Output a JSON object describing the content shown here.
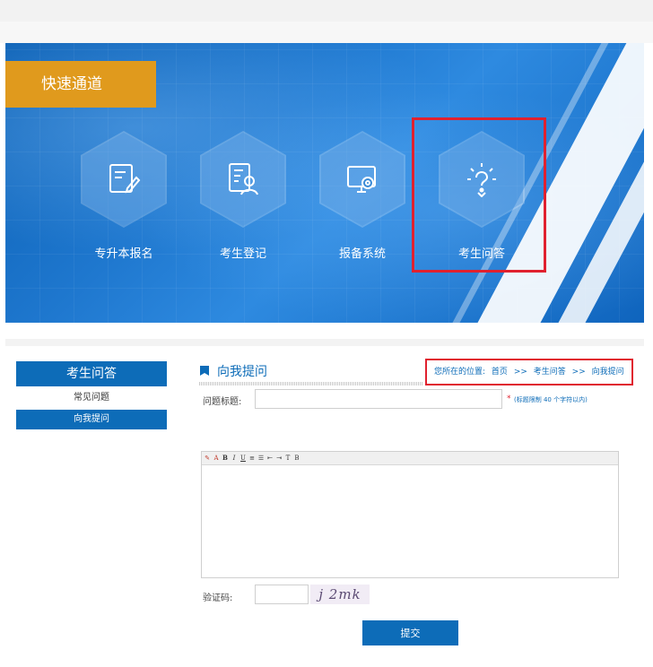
{
  "banner": {
    "quick_label": "快速通道",
    "items": [
      {
        "label": "专升本报名",
        "icon": "edit-document-icon"
      },
      {
        "label": "考生登记",
        "icon": "user-document-icon"
      },
      {
        "label": "报备系统",
        "icon": "monitor-gear-icon"
      },
      {
        "label": "考生问答",
        "icon": "question-bulb-icon"
      }
    ]
  },
  "sidebar": {
    "title": "考生问答",
    "items": [
      {
        "label": "常见问题"
      },
      {
        "label": "向我提问"
      }
    ]
  },
  "main": {
    "title": "向我提问",
    "breadcrumb": {
      "prefix": "您所在的位置:",
      "home": "首页",
      "sep1": ">>",
      "section": "考生问答",
      "sep2": ">>",
      "current": "向我提问"
    },
    "form": {
      "title_label": "问题标题:",
      "title_value": "",
      "required_mark": "*",
      "title_hint": "(标题限制 40 个字符以内)",
      "captcha_label": "验证码:",
      "captcha_value": "",
      "captcha_text": "j 2mk",
      "submit_label": "提交"
    }
  },
  "colors": {
    "primary": "#0d6cb8",
    "accent": "#e09a1d",
    "highlight": "#e0212f"
  }
}
